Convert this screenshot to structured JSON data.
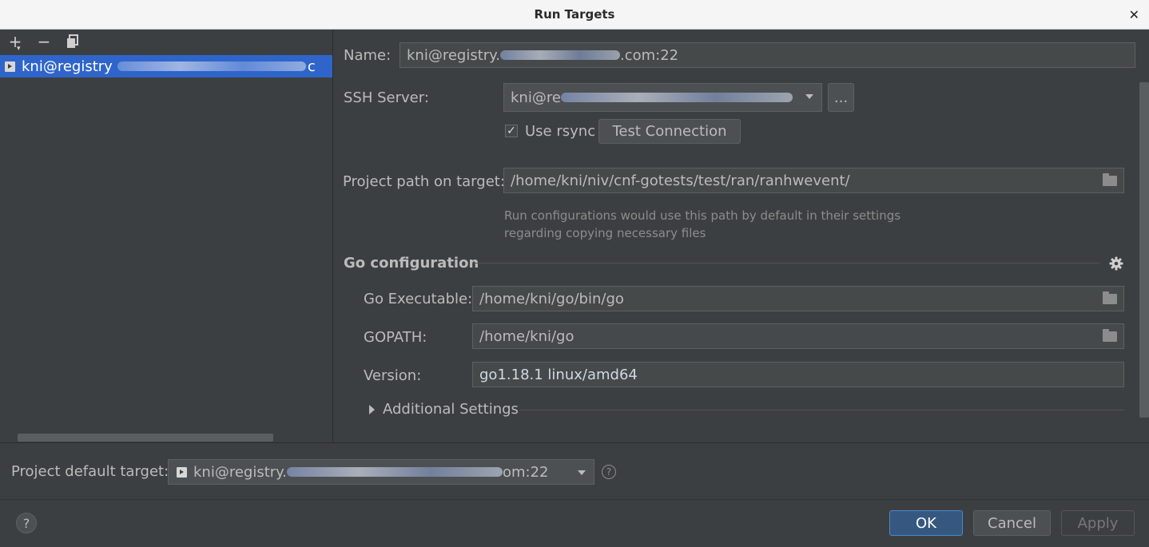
{
  "window": {
    "title": "Run Targets",
    "close_glyph": "✕"
  },
  "toolbar": {
    "add_icon": "plus-icon",
    "remove_icon": "minus-icon",
    "copy_icon": "copy-icon",
    "add_glyph": "+",
    "remove_glyph": "−"
  },
  "targets_list": {
    "items": [
      {
        "label_visible": "kni@registry",
        "label_tail": "c"
      }
    ]
  },
  "form": {
    "name_label": "Name:",
    "name_value_prefix": "kni@registry.",
    "name_value_suffix": ".com:22",
    "ssh_server_label": "SSH Server:",
    "ssh_server_value_prefix": "kni@re",
    "ssh_more_button": "...",
    "use_rsync_label": "Use rsync",
    "use_rsync_checked": true,
    "check_glyph": "✓",
    "test_connection_button": "Test Connection",
    "project_path_label": "Project path on target:",
    "project_path_value": "/home/kni/niv/cnf-gotests/test/ran/ranhwevent/",
    "project_path_hint_line1": "Run configurations would use this path by default in their settings",
    "project_path_hint_line2": "regarding copying necessary files"
  },
  "go_config": {
    "section_title": "Go configuration",
    "go_executable_label": "Go Executable:",
    "go_executable_value": "/home/kni/go/bin/go",
    "gopath_label": "GOPATH:",
    "gopath_value": "/home/kni/go",
    "version_label": "Version:",
    "version_value": "go1.18.1 linux/amd64",
    "additional_settings": "Additional Settings"
  },
  "default_target": {
    "label": "Project default target:",
    "value_prefix": "kni@registry.",
    "value_suffix": "om:22",
    "help_glyph": "?"
  },
  "footer": {
    "help_glyph": "?",
    "ok_button": "OK",
    "cancel_button": "Cancel",
    "apply_button": "Apply"
  },
  "colors": {
    "background": "#3c3f41",
    "selection": "#2f65ca",
    "ok_button": "#365880",
    "field": "#45494a"
  }
}
